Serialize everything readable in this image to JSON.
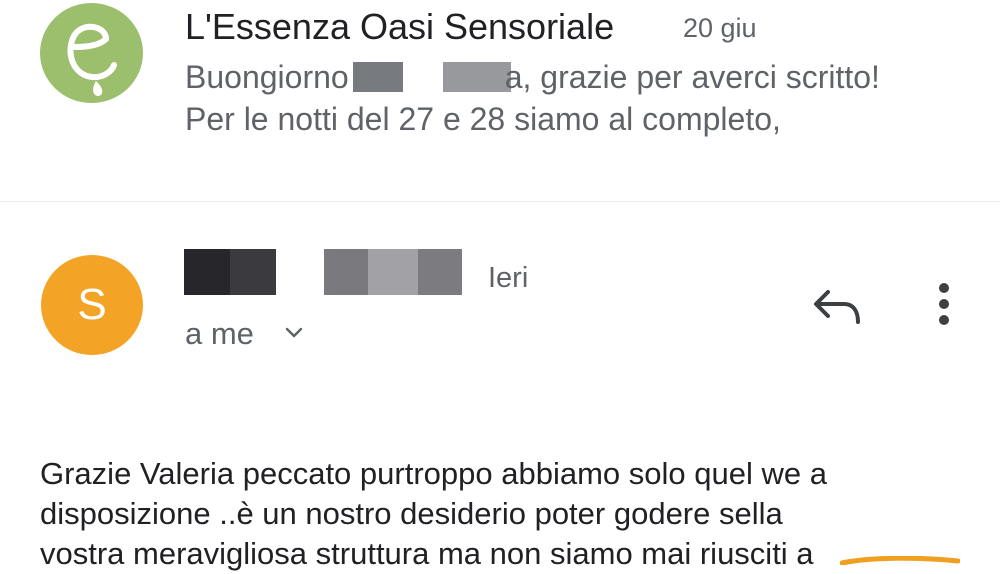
{
  "previous_message": {
    "sender": "L'Essenza Oasi Sensoriale",
    "date": "20 giu",
    "snippet_greeting": "Buongiorno",
    "snippet_after_redaction": "a, grazie per averci scritto!",
    "snippet_line2": "Per le notti del 27 e 28 siamo al completo,",
    "avatar_color": "#9cbf6e"
  },
  "current_message": {
    "avatar_letter": "S",
    "avatar_color": "#f3a326",
    "date": "Ieri",
    "recipient": "a me",
    "actions": {
      "reply_icon": "reply-icon",
      "more_icon": "more-vert-icon"
    },
    "body_lines": [
      "Grazie Valeria peccato purtroppo abbiamo solo quel we a",
      "disposizione ..è un nostro desiderio poter godere sella",
      "vostra meravigliosa struttura ma non siamo mai riusciti a"
    ]
  }
}
